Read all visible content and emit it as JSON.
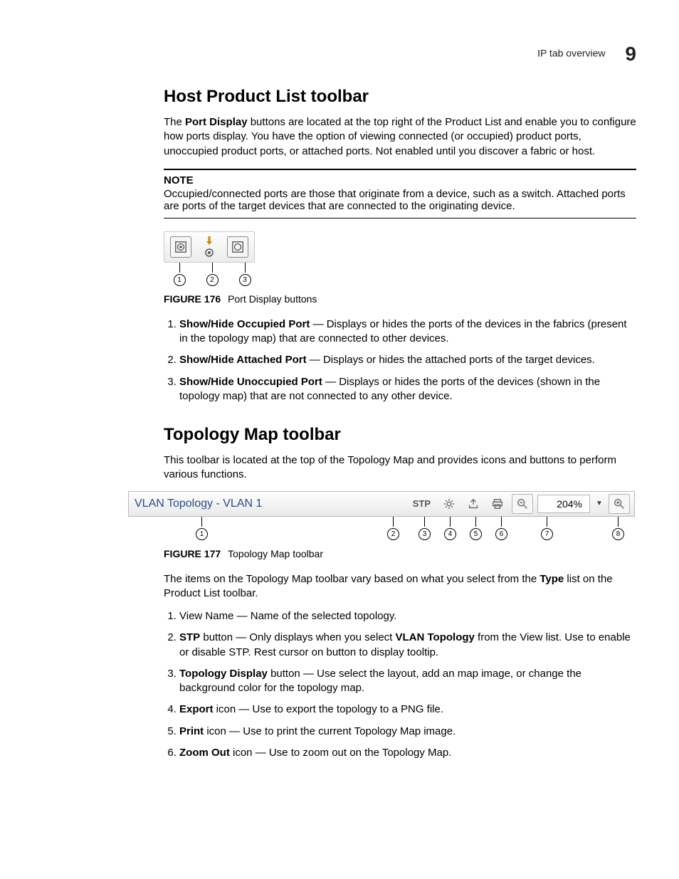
{
  "header": {
    "running_head": "IP tab overview",
    "chapter_number": "9"
  },
  "section1": {
    "title": "Host Product List toolbar",
    "intro_pre": "The ",
    "intro_bold": "Port Display",
    "intro_post": " buttons are located at the top right of the Product List and enable you to configure how ports display. You have the option of viewing connected (or occupied) product ports, unoccupied product ports, or attached ports. Not enabled until you discover a fabric or host.",
    "note_label": "NOTE",
    "note_text": "Occupied/connected ports are those that originate from a device, such as a switch. Attached ports are ports of the target devices that are connected to the originating device.",
    "figure": {
      "fignum": "FIGURE 176",
      "caption": "Port Display buttons",
      "callouts": [
        "1",
        "2",
        "3"
      ]
    },
    "items": [
      {
        "bold": "Show/Hide Occupied Port",
        "rest": " — Displays or hides the ports of the devices in the fabrics (present in the topology map) that are connected to other devices."
      },
      {
        "bold": "Show/Hide Attached Port",
        "rest": " — Displays or hides the attached ports of the target devices."
      },
      {
        "bold": "Show/Hide Unoccupied Port",
        "rest": " — Displays or hides the ports of the devices (shown in the topology map) that are not connected to any other device."
      }
    ]
  },
  "section2": {
    "title": "Topology Map toolbar",
    "intro": "This toolbar is located at the top of the Topology Map and provides icons and buttons to perform various functions.",
    "toolbar": {
      "view_name": "VLAN Topology - VLAN 1",
      "stp_label": "STP",
      "zoom_level": "204%"
    },
    "figure": {
      "fignum": "FIGURE 177",
      "caption": "Topology Map toolbar",
      "callouts": [
        "1",
        "2",
        "3",
        "4",
        "5",
        "6",
        "7",
        "8"
      ]
    },
    "desc_pre": "The items on the Topology Map toolbar vary based on what you select from the ",
    "desc_bold": "Type",
    "desc_post": " list on the Product List toolbar.",
    "items": [
      {
        "text_before": "View Name — Name of the selected topology."
      },
      {
        "bold": "STP",
        "mid": " button — Only displays when you select ",
        "bold2": "VLAN Topology",
        "rest": " from the View list. Use to enable or disable STP. Rest cursor on button to display tooltip."
      },
      {
        "bold": "Topology Display",
        "rest": " button — Use select the layout, add an map image, or change the background color for the topology map."
      },
      {
        "bold": "Export",
        "rest": " icon — Use to export the topology to a PNG file."
      },
      {
        "bold": "Print",
        "rest": " icon — Use to print the current Topology Map image."
      },
      {
        "bold": "Zoom Out",
        "rest": " icon — Use to zoom out on the Topology Map."
      }
    ]
  }
}
